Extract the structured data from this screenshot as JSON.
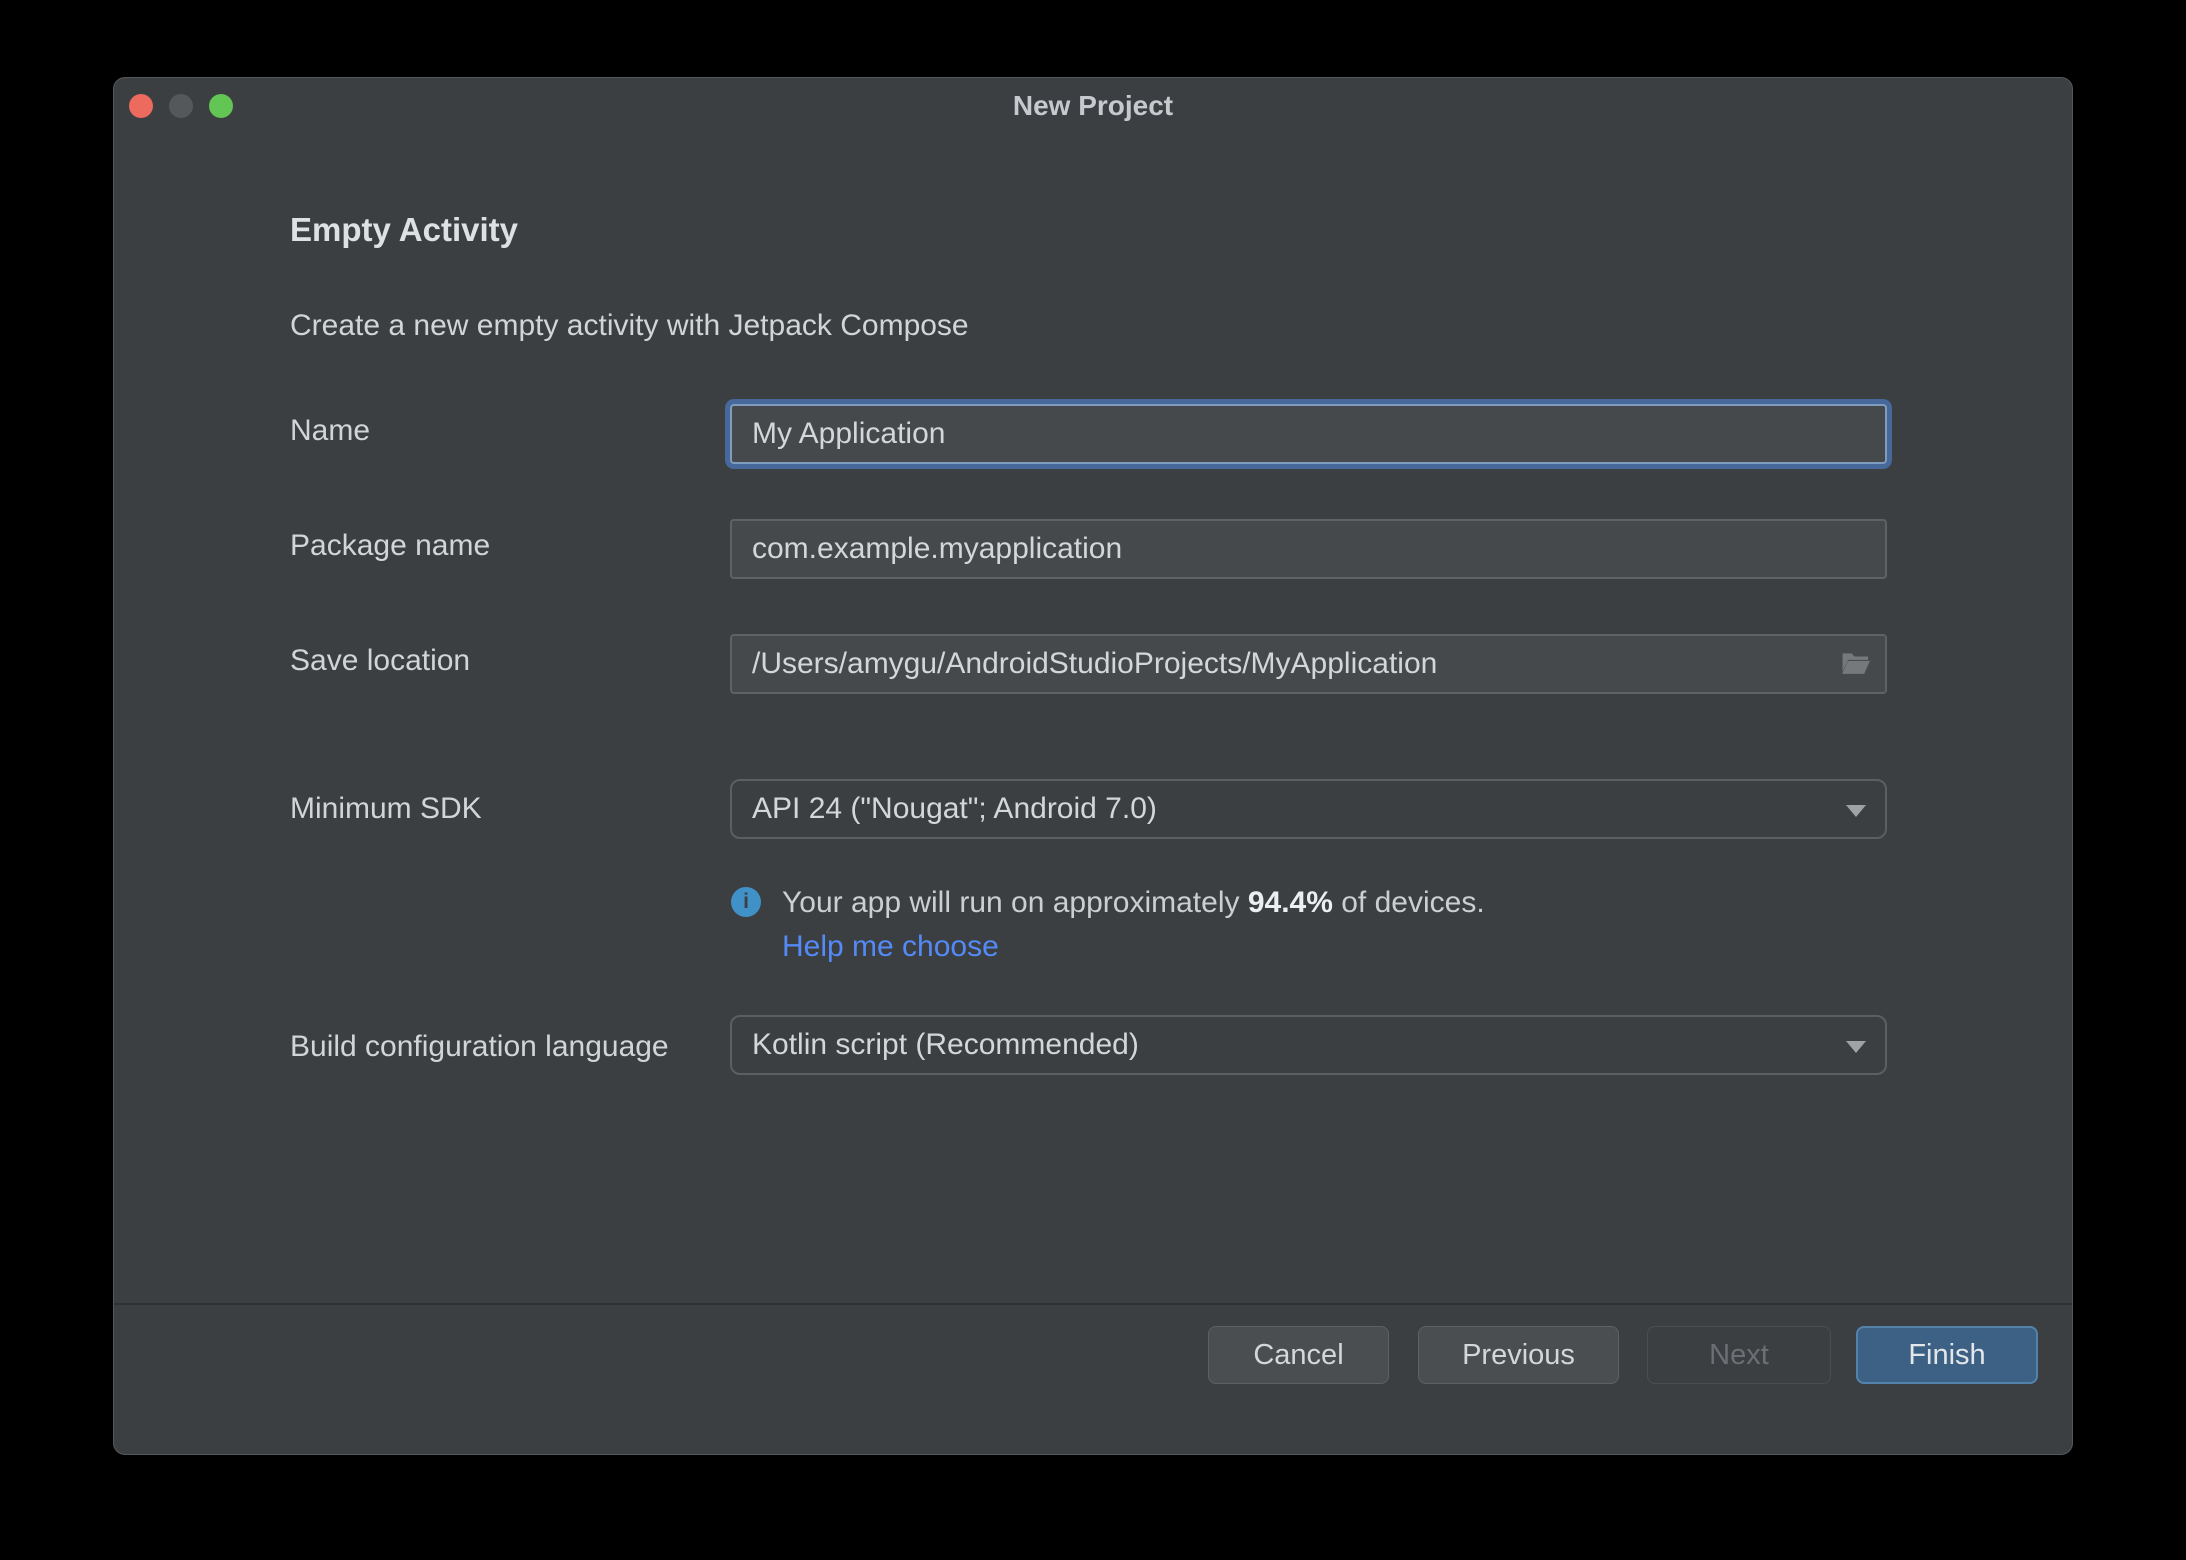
{
  "window": {
    "title": "New Project"
  },
  "header": {
    "heading": "Empty Activity",
    "subtitle": "Create a new empty activity with Jetpack Compose"
  },
  "form": {
    "name": {
      "label": "Name",
      "value": "My Application"
    },
    "package": {
      "label": "Package name",
      "value": "com.example.myapplication"
    },
    "save_location": {
      "label": "Save location",
      "value": "/Users/amygu/AndroidStudioProjects/MyApplication"
    },
    "min_sdk": {
      "label": "Minimum SDK",
      "value": "API 24 (\"Nougat\"; Android 7.0)"
    },
    "sdk_info": {
      "prefix": "Your app will run on approximately ",
      "highlight": "94.4%",
      "suffix": " of devices.",
      "link": "Help me choose"
    },
    "build_config": {
      "label": "Build configuration language",
      "value": "Kotlin script (Recommended)"
    }
  },
  "footer": {
    "cancel": "Cancel",
    "previous": "Previous",
    "next": "Next",
    "finish": "Finish"
  },
  "icons": {
    "info": "i",
    "folder": "open-folder-glyph",
    "dropdown_arrow": "triangle-down"
  },
  "colors": {
    "window_bg": "#3c3f41",
    "canvas_bg": "#000000",
    "field_bg": "#45494b",
    "field_border": "#5e6264",
    "focus_ring": "#47689b",
    "focus_border": "#7f9cbf",
    "link_blue": "#548af7",
    "info_icon_blue": "#4191c9",
    "finish_bg": "#3d6185",
    "finish_border": "#5383ab",
    "traffic_red": "#ec6a5e",
    "traffic_gray": "#55585a",
    "traffic_green": "#62c554",
    "text_primary": "#d4d6d8",
    "text_disabled": "#6c7074"
  }
}
